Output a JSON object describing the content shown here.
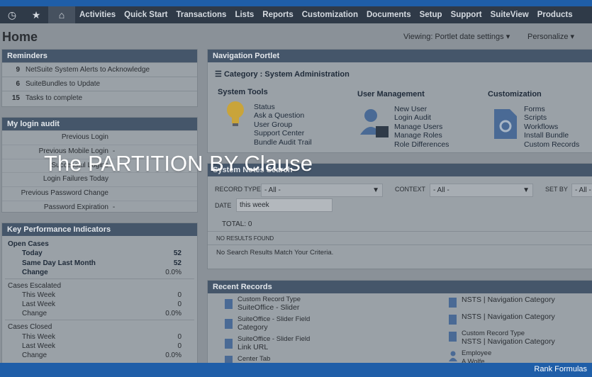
{
  "nav": {
    "items": [
      "Activities",
      "Quick Start",
      "Transactions",
      "Lists",
      "Reports",
      "Customization",
      "Documents",
      "Setup",
      "Support",
      "SuiteView",
      "Products"
    ],
    "icons": [
      "clock-icon",
      "star-icon",
      "home-icon"
    ]
  },
  "page": {
    "title": "Home",
    "viewing": "Viewing: Portlet date settings",
    "personalize": "Personalize"
  },
  "reminders": {
    "title": "Reminders",
    "rows": [
      {
        "count": "9",
        "label": "NetSuite System Alerts to Acknowledge"
      },
      {
        "count": "6",
        "label": "SuiteBundles to Update"
      },
      {
        "count": "15",
        "label": "Tasks to complete"
      }
    ]
  },
  "login_audit": {
    "title": "My login audit",
    "rows": [
      {
        "label": "Previous Login",
        "value": ""
      },
      {
        "label": "Previous Mobile Login",
        "value": "-"
      },
      {
        "label": "Successful Logins",
        "value": ""
      },
      {
        "label": "Login Failures Today",
        "value": ""
      },
      {
        "label": "Previous Password Change",
        "value": ""
      },
      {
        "label": "Password Expiration",
        "value": "-"
      }
    ]
  },
  "kpi": {
    "title": "Key Performance Indicators",
    "open_cases": "Open Cases",
    "today": "Today",
    "today_val": "52",
    "same_day": "Same Day Last Month",
    "same_day_val": "52",
    "change": "Change",
    "change_val": "0.0%",
    "escalated": "Cases Escalated",
    "esc_this": "This Week",
    "esc_this_val": "0",
    "esc_last": "Last Week",
    "esc_last_val": "0",
    "esc_change": "Change",
    "esc_change_val": "0.0%",
    "closed": "Cases Closed",
    "cl_this": "This Week",
    "cl_this_val": "0",
    "cl_last": "Last Week",
    "cl_last_val": "0",
    "cl_change": "Change",
    "cl_change_val": "0.0%"
  },
  "nav_portlet": {
    "title": "Navigation Portlet",
    "category": "Category : System Administration",
    "system_tools": {
      "title": "System Tools",
      "links": [
        "Status",
        "Ask a Question",
        "User Group",
        "Support Center",
        "Bundle Audit Trail"
      ]
    },
    "user_management": {
      "title": "User Management",
      "links": [
        "New User",
        "Login Audit",
        "Manage Users",
        "Manage Roles",
        "Role Differences"
      ]
    },
    "customization": {
      "title": "Customization",
      "links": [
        "Forms",
        "Scripts",
        "Workflows",
        "Install Bundle",
        "Custom Records"
      ]
    }
  },
  "overlay_title": "The PARTITION BY Clause",
  "system_notes": {
    "title": "System Notes Search",
    "record_type_label": "RECORD TYPE",
    "record_type_value": "- All -",
    "context_label": "CONTEXT",
    "context_value": "- All -",
    "set_by_label": "SET BY",
    "set_by_value": "- All -",
    "date_label": "DATE",
    "date_value": "this week",
    "total": "TOTAL: 0",
    "no_results": "NO RESULTS FOUND",
    "no_match": "No Search Results Match Your Criteria."
  },
  "recent": {
    "title": "Recent Records",
    "left": [
      {
        "type": "Custom Record Type",
        "name": "SuiteOffice - Slider"
      },
      {
        "type": "SuiteOffice - Slider Field",
        "name": "Category"
      },
      {
        "type": "SuiteOffice - Slider Field",
        "name": "Link URL"
      },
      {
        "type": "Center Tab",
        "name": ""
      }
    ],
    "right": [
      {
        "type": "",
        "name": "NSTS | Navigation Category"
      },
      {
        "type": "",
        "name": "NSTS | Navigation Category"
      },
      {
        "type": "Custom Record Type",
        "name": "NSTS | Navigation Category"
      },
      {
        "type": "Employee",
        "name": "A Wolfe"
      }
    ]
  },
  "footer": {
    "label": "Rank Formulas"
  }
}
